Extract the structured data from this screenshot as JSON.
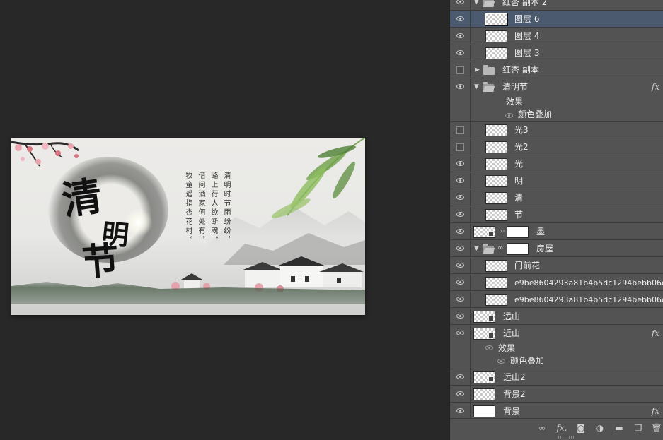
{
  "artwork": {
    "calligraphy": [
      "清",
      "明",
      "节"
    ],
    "poem_lines": [
      "清明时节雨纷纷，",
      "路上行人欲断魂。",
      "借问酒家何处有，",
      "牧童遥指杏花村。"
    ]
  },
  "layers": [
    {
      "name": "红杏 副本 2",
      "type": "group",
      "expanded": true,
      "visible": true
    },
    {
      "name": "图层 6",
      "type": "layer",
      "visible": true,
      "selected": true
    },
    {
      "name": "图层 4",
      "type": "layer",
      "visible": true
    },
    {
      "name": "图层 3",
      "type": "layer",
      "visible": true
    },
    {
      "name": "红杏 副本",
      "type": "group",
      "expanded": false,
      "visible": false
    },
    {
      "name": "清明节",
      "type": "group",
      "expanded": true,
      "visible": true,
      "fx": "fx"
    },
    {
      "name": "光3",
      "type": "layer",
      "visible": false
    },
    {
      "name": "光2",
      "type": "layer",
      "visible": false
    },
    {
      "name": "光",
      "type": "layer",
      "visible": true
    },
    {
      "name": "明",
      "type": "layer",
      "visible": true
    },
    {
      "name": "清",
      "type": "layer",
      "visible": true
    },
    {
      "name": "节",
      "type": "layer",
      "visible": true
    },
    {
      "name": "墨",
      "type": "layer",
      "visible": true
    },
    {
      "name": "房屋",
      "type": "group",
      "expanded": true,
      "visible": true
    },
    {
      "name": "门前花",
      "type": "layer",
      "visible": true
    },
    {
      "name": "e9be8604293a81b4b5dc1294bebb06c0...",
      "type": "layer",
      "visible": true
    },
    {
      "name": "e9be8604293a81b4b5dc1294bebb06c0...",
      "type": "layer",
      "visible": true
    },
    {
      "name": "远山",
      "type": "smart",
      "visible": true
    },
    {
      "name": "近山",
      "type": "smart",
      "visible": true,
      "fx": "fx"
    },
    {
      "name": "远山2",
      "type": "smart",
      "visible": true
    },
    {
      "name": "背景2",
      "type": "layer",
      "visible": true
    },
    {
      "name": "背景",
      "type": "layer",
      "visible": true,
      "fx": "fx"
    }
  ],
  "effects": {
    "label": "效果",
    "color_overlay": "颜色叠加"
  },
  "footer_icons": [
    "link-icon",
    "fx",
    "mask-icon",
    "adjustment-icon",
    "folder-icon",
    "new-layer-icon",
    "trash-icon"
  ],
  "footer_fx_label": "fx.",
  "colors": {
    "panel_bg": "#535353",
    "selected_row": "#4b5a6e",
    "canvas_bg": "#282828"
  }
}
